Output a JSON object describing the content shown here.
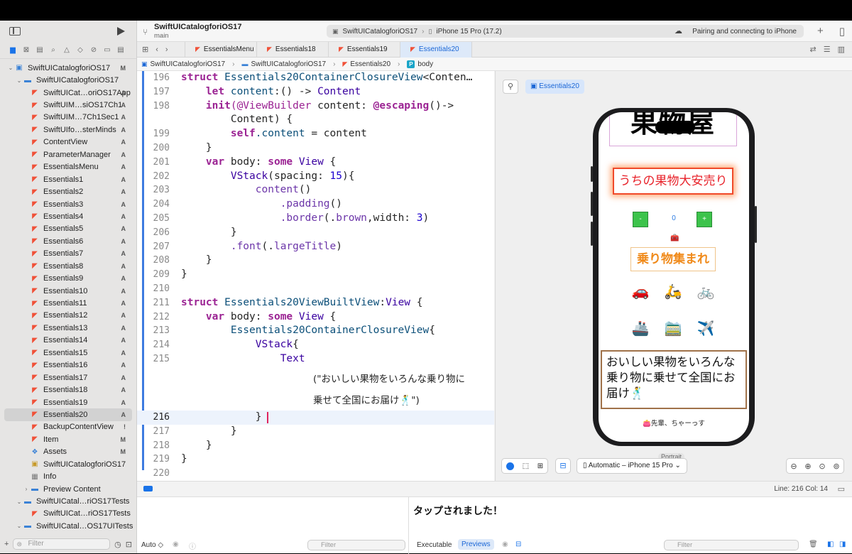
{
  "project": {
    "name": "SwiftUICatalogforiOS17",
    "branch": "main"
  },
  "toolbar": {
    "scheme": "SwiftUICatalogforiOS17",
    "device": "iPhone 15 Pro (17.2)",
    "status": "Pairing and connecting to iPhone"
  },
  "tabs": [
    {
      "label": "EssentialsMenu"
    },
    {
      "label": "Essentials18"
    },
    {
      "label": "Essentials19"
    },
    {
      "label": "Essentials20"
    }
  ],
  "breadcrumb": {
    "c1": "SwiftUICatalogforiOS17",
    "c2": "SwiftUICatalogforiOS17",
    "c3": "Essentials20",
    "c4_icon": "P",
    "c4": "body"
  },
  "navigator": {
    "items": [
      {
        "label": "SwiftUICatalogforiOS17",
        "badge": "M"
      },
      {
        "label": "SwiftUICatalogforiOS17",
        "badge": ""
      },
      {
        "label": "SwiftUICat…oriOS17App",
        "badge": "A"
      },
      {
        "label": "SwiftUIM…siOS17Ch1",
        "badge": "A"
      },
      {
        "label": "SwiftUIM…7Ch1Sec1",
        "badge": "A"
      },
      {
        "label": "SwiftUIfo…sterMinds",
        "badge": "A"
      },
      {
        "label": "ContentView",
        "badge": "A"
      },
      {
        "label": "ParameterManager",
        "badge": "A"
      },
      {
        "label": "EssentialsMenu",
        "badge": "A"
      },
      {
        "label": "Essentials1",
        "badge": "A"
      },
      {
        "label": "Essentials2",
        "badge": "A"
      },
      {
        "label": "Essentials3",
        "badge": "A"
      },
      {
        "label": "Essentials4",
        "badge": "A"
      },
      {
        "label": "Essentials5",
        "badge": "A"
      },
      {
        "label": "Essentials6",
        "badge": "A"
      },
      {
        "label": "Essentials7",
        "badge": "A"
      },
      {
        "label": "Essentials8",
        "badge": "A"
      },
      {
        "label": "Essentials9",
        "badge": "A"
      },
      {
        "label": "Essentials10",
        "badge": "A"
      },
      {
        "label": "Essentials11",
        "badge": "A"
      },
      {
        "label": "Essentials12",
        "badge": "A"
      },
      {
        "label": "Essentials13",
        "badge": "A"
      },
      {
        "label": "Essentials14",
        "badge": "A"
      },
      {
        "label": "Essentials15",
        "badge": "A"
      },
      {
        "label": "Essentials16",
        "badge": "A"
      },
      {
        "label": "Essentials17",
        "badge": "A"
      },
      {
        "label": "Essentials18",
        "badge": "A"
      },
      {
        "label": "Essentials19",
        "badge": "A"
      },
      {
        "label": "Essentials20",
        "badge": "A"
      },
      {
        "label": "BackupContentView",
        "badge": "!"
      },
      {
        "label": "Item",
        "badge": "M"
      },
      {
        "label": "Assets",
        "badge": "M"
      },
      {
        "label": "SwiftUICatalogforiOS17",
        "badge": ""
      },
      {
        "label": "Info",
        "badge": ""
      },
      {
        "label": "Preview Content",
        "badge": ""
      },
      {
        "label": "SwiftUICatal…riOS17Tests",
        "badge": ""
      },
      {
        "label": "SwiftUICat…riOS17Tests",
        "badge": ""
      },
      {
        "label": "SwiftUICatal…OS17UITests",
        "badge": ""
      }
    ],
    "filter_placeholder": "Filter"
  },
  "code": {
    "l196": "196",
    "l197": "197",
    "l198": "198",
    "l199": "199",
    "l200": "200",
    "l201": "201",
    "l202": "202",
    "l203": "203",
    "l204": "204",
    "l205": "205",
    "l206": "206",
    "l207": "207",
    "l208": "208",
    "l209": "209",
    "l210": "210",
    "l211": "211",
    "l212": "212",
    "l213": "213",
    "l214": "214",
    "l215": "215",
    "l216": "216",
    "l217": "217",
    "l218": "218",
    "l219": "219",
    "l220": "220",
    "s196a": "struct",
    "s196b": "Essentials20ContainerClosureView",
    "s196c": "<Conten…",
    "s197a": "let",
    "s197b": "content",
    "s197c": ":() -> ",
    "s197d": "Content",
    "s198a": "init",
    "s198b": "(@ViewBuilder",
    "s198c": " content: ",
    "s198d": "@escaping",
    "s198e": "()->",
    "s198f": "Content) {",
    "s199a": "self",
    "s199b": ".content",
    "s199c": " = content",
    "s200": "}",
    "s201a": "var",
    "s201b": " body: ",
    "s201c": "some",
    "s201d": "View",
    "s201e": " {",
    "s202a": "VStack",
    "s202b": "(spacing: ",
    "s202c": "15",
    "s202d": "){",
    "s203a": "content",
    "s203b": "()",
    "s204a": ".padding",
    "s204b": "()",
    "s205a": ".border",
    "s205b": "(.",
    "s205c": "brown",
    "s205d": ",width: ",
    "s205e": "3",
    "s205f": ")",
    "s206": "}",
    "s207a": ".font",
    "s207b": "(.",
    "s207c": "largeTitle",
    "s207d": ")",
    "s208": "}",
    "s209": "}",
    "s211a": "struct",
    "s211b": "Essentials20ViewBuiltView",
    "s211c": ":",
    "s211d": "View",
    "s211e": " {",
    "s212a": "var",
    "s212b": " body: ",
    "s212c": "some",
    "s212d": "View",
    "s212e": " {",
    "s213a": "Essentials20ContainerClosureView",
    "s213b": "{",
    "s214a": "VStack",
    "s214b": "{",
    "s215": "Text",
    "s215b": "(\"おいしい果物をいろんな乗り物に",
    "s215c": "乗せて全国にお届け🕺\")",
    "s216": "}",
    "s217": "}",
    "s218": "}",
    "s219": "}"
  },
  "preview": {
    "chip": "Essentials20",
    "heading": "果物屋",
    "sale": "うちの果物大安売り",
    "minus": "-",
    "count": "0",
    "plus": "+",
    "vehicles_title": "乗り物集まれ",
    "row1": [
      "🚗",
      "🛵",
      "🚲"
    ],
    "row2": [
      "🚢",
      "🚞",
      "✈️"
    ],
    "message": "おいしい果物をいろんな乗り物に乗せて全国にお届け🕺",
    "footer": "👛先輩、ちゃーっす",
    "orientation": "Portrait",
    "device_picker": "Automatic – iPhone 15 Pro"
  },
  "status": {
    "linecol": "Line: 216  Col: 14"
  },
  "debug": {
    "output": "タップされました！",
    "auto": "Auto ◇",
    "executable": "Executable",
    "previews": "Previews",
    "filter": "Filter"
  }
}
